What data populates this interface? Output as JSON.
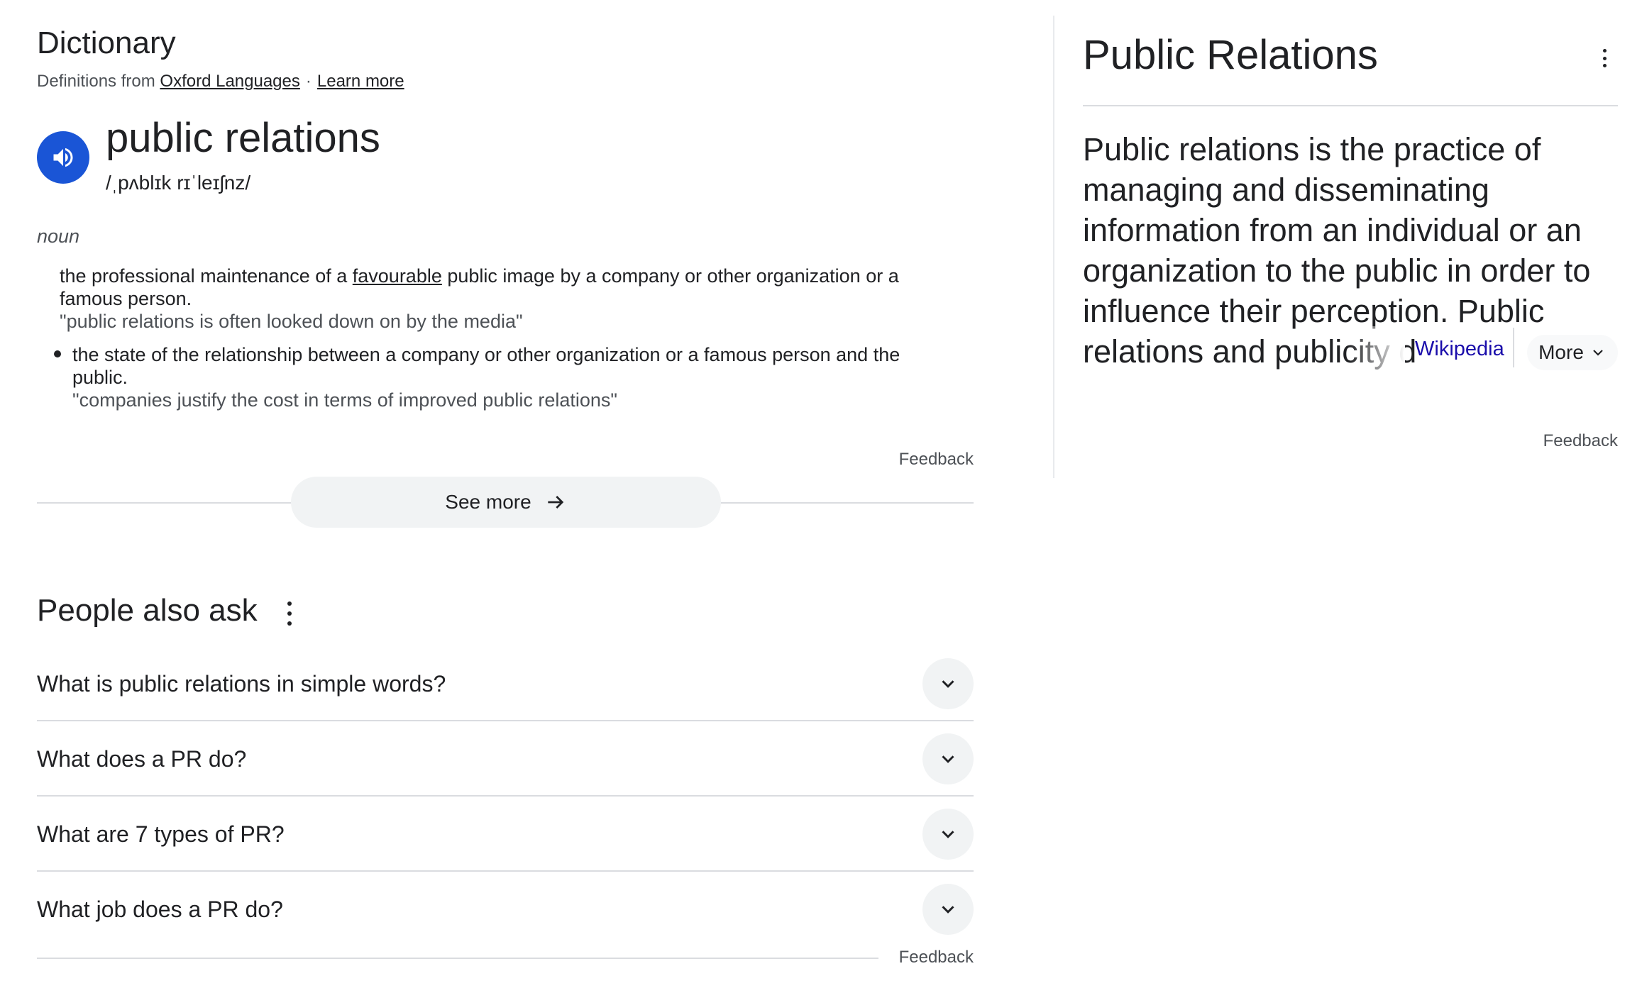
{
  "dictionary": {
    "title": "Dictionary",
    "source_prefix": "Definitions from",
    "source_name": "Oxford Languages",
    "separator": "·",
    "learn_more": "Learn more",
    "headword": "public relations",
    "phonetic": "/ˌpʌblɪk rɪˈleɪʃnz/",
    "part_of_speech": "noun",
    "definitions": [
      {
        "text_before": "the professional maintenance of a ",
        "link_word": "favourable",
        "text_after": " public image by a company or other organization or a famous person.",
        "example": "\"public relations is often looked down on by the media\""
      },
      {
        "text": "the state of the relationship between a company or other organization or a famous person and the public.",
        "example": "\"companies justify the cost in terms of improved public relations\""
      }
    ],
    "feedback": "Feedback",
    "see_more": "See more",
    "icons": {
      "speaker": "speaker-icon",
      "see_more": "arrow-right-icon"
    },
    "accent_color": "#1a55d6"
  },
  "people_also_ask": {
    "title": "People also ask",
    "questions": [
      "What is public relations in simple words?",
      "What does a PR do?",
      "What are 7 types of PR?",
      "What job does a PR do?"
    ],
    "feedback": "Feedback",
    "icons": {
      "menu": "more-vert-icon",
      "expand": "chevron-down-icon"
    }
  },
  "knowledge_panel": {
    "title": "Public Relations",
    "description": "Public relations is the practice of managing and disseminating information from an individual or an organization to the public in order to influence their perception. Public relations and publicity d",
    "source": "Wikipedia",
    "more": "More",
    "feedback": "Feedback",
    "link_color": "#1a0dab",
    "icons": {
      "menu": "more-vert-icon",
      "more": "chevron-down-icon"
    }
  }
}
